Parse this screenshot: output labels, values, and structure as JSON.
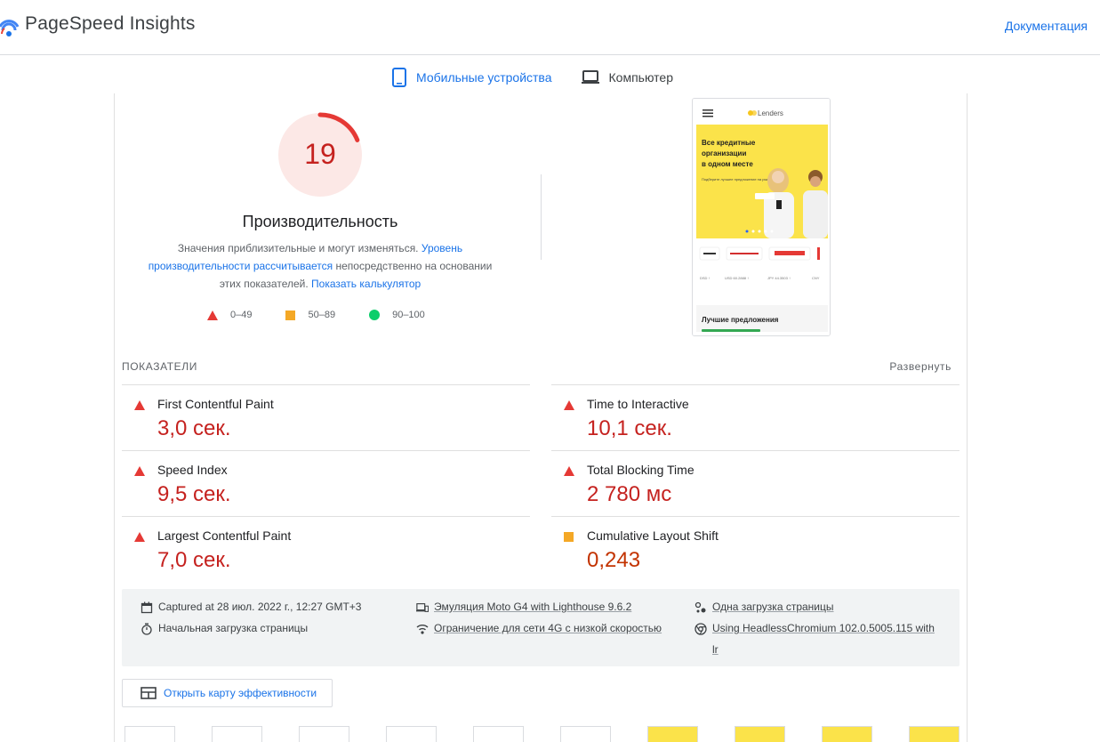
{
  "header": {
    "title": "PageSpeed Insights",
    "docs_link": "Документация"
  },
  "tabs": [
    {
      "label": "Мобильные устройства",
      "icon": "smartphone-icon",
      "active": true
    },
    {
      "label": "Компьютер",
      "icon": "laptop-icon",
      "active": false
    }
  ],
  "performance": {
    "score": "19",
    "score_fraction": 0.19,
    "title": "Производительность",
    "desc_1": "Значения приблизительные и могут изменяться.",
    "desc_link_1": "Уровень производительности рассчитывается",
    "desc_2": "непосредственно на основании этих показателей.",
    "desc_link_2": "Показать калькулятор"
  },
  "legend": [
    {
      "label": "0–49",
      "shape": "triangle",
      "color": "#e53935"
    },
    {
      "label": "50–89",
      "shape": "square",
      "color": "#f4a826"
    },
    {
      "label": "90–100",
      "shape": "circle",
      "color": "#0cce6b"
    }
  ],
  "preview": {
    "brand": "Lenders",
    "hero_line1": "Все кредитные",
    "hero_line2": "организации",
    "hero_line3": "в одном месте",
    "hero_sub": "Подберите лучшее предложение на рынке!",
    "rates": [
      "DSD ↑",
      "USD 60.2888 ↑",
      "JPY 44.3503 ↑",
      "CNY"
    ],
    "best": "Лучшие предложения"
  },
  "metrics_section": {
    "heading": "ПОКАЗАТЕЛИ",
    "expand": "Развернуть"
  },
  "metrics": [
    {
      "name": "First Contentful Paint",
      "value": "3,0 сек.",
      "status": "fail"
    },
    {
      "name": "Time to Interactive",
      "value": "10,1 сек.",
      "status": "fail"
    },
    {
      "name": "Speed Index",
      "value": "9,5 сек.",
      "status": "fail"
    },
    {
      "name": "Total Blocking Time",
      "value": "2 780 мс",
      "status": "fail"
    },
    {
      "name": "Largest Contentful Paint",
      "value": "7,0 сек.",
      "status": "fail"
    },
    {
      "name": "Cumulative Layout Shift",
      "value": "0,243",
      "status": "average"
    }
  ],
  "environment": {
    "captured": "Captured at 28 июл. 2022 г., 12:27 GMT+3",
    "initial_load": "Начальная загрузка страницы",
    "emulation": "Эмуляция Moto G4 with Lighthouse 9.6.2",
    "throttling": "Ограничение для сети 4G с низкой скоростью",
    "single_load": "Одна загрузка страницы",
    "browser_line1": "Using HeadlessChromium 102.0.5005.115 with",
    "browser_line2": "lr"
  },
  "treemap_button": "Открыть карту эффективности",
  "colors": {
    "accent": "#1a73e8",
    "fail": "#c5221f",
    "average": "#c33300",
    "gauge_fail": "#e53935",
    "gauge_bg": "#fce8e6"
  }
}
